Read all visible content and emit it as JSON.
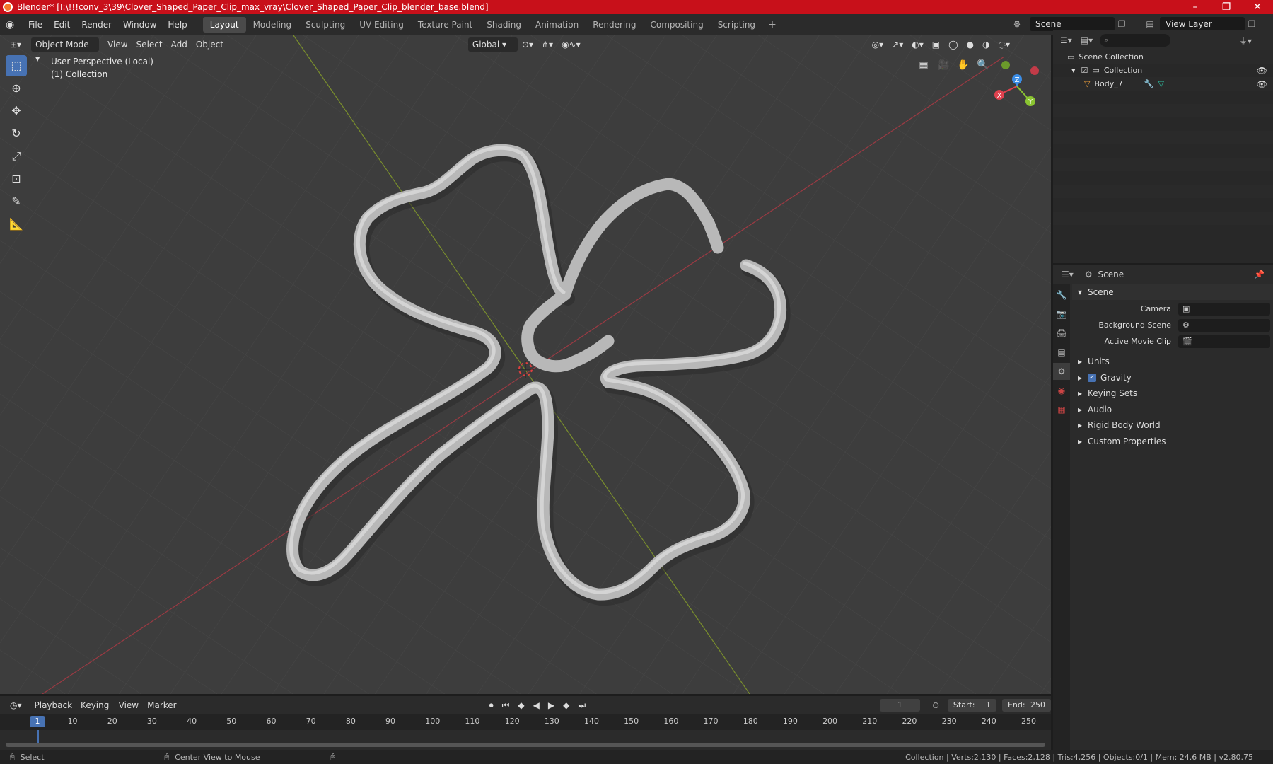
{
  "window": {
    "title": "Blender* [I:\\!!!conv_3\\39\\Clover_Shaped_Paper_Clip_max_vray\\Clover_Shaped_Paper_Clip_blender_base.blend]",
    "min": "–",
    "max": "❐",
    "close": "✕"
  },
  "menu": {
    "file": "File",
    "edit": "Edit",
    "render": "Render",
    "window": "Window",
    "help": "Help"
  },
  "workspaces": [
    "Layout",
    "Modeling",
    "Sculpting",
    "UV Editing",
    "Texture Paint",
    "Shading",
    "Animation",
    "Rendering",
    "Compositing",
    "Scripting"
  ],
  "workspace_add": "+",
  "scene_name": "Scene",
  "view_layer": "View Layer",
  "viewport": {
    "mode": "Object Mode",
    "menus": {
      "view": "View",
      "select": "Select",
      "add": "Add",
      "object": "Object"
    },
    "orientation": "Global",
    "overlay_line1": "User Perspective (Local)",
    "overlay_line2": "(1) Collection"
  },
  "gizmo": {
    "x": "X",
    "y": "Y",
    "z": "Z"
  },
  "outliner": {
    "search_placeholder": "",
    "scene_collection": "Scene Collection",
    "collection": "Collection",
    "object": "Body_7"
  },
  "properties": {
    "header": "Scene",
    "panel": "Scene",
    "camera_label": "Camera",
    "bg_scene_label": "Background Scene",
    "movie_clip_label": "Active Movie Clip",
    "subpanels": {
      "units": "Units",
      "gravity": "Gravity",
      "keying_sets": "Keying Sets",
      "audio": "Audio",
      "rigid_body": "Rigid Body World",
      "custom_props": "Custom Properties"
    }
  },
  "timeline": {
    "menus": {
      "playback": "Playback",
      "keying": "Keying",
      "view": "View",
      "marker": "Marker"
    },
    "current_frame": "1",
    "start_label": "Start:",
    "start": "1",
    "end_label": "End:",
    "end": "250",
    "ruler_ticks": [
      "1",
      "10",
      "20",
      "30",
      "40",
      "50",
      "60",
      "70",
      "80",
      "90",
      "100",
      "110",
      "120",
      "130",
      "140",
      "150",
      "160",
      "170",
      "180",
      "190",
      "200",
      "210",
      "220",
      "230",
      "240",
      "250"
    ]
  },
  "status": {
    "select": "Select",
    "center_view": "Center View to Mouse",
    "stats": "Collection | Verts:2,130 | Faces:2,128 | Tris:4,256 | Objects:0/1 | Mem: 24.6 MB | v2.80.75"
  },
  "colors": {
    "accent": "#4772b3",
    "titlebar": "#c8101a",
    "x_axis": "#e0414e",
    "y_axis": "#8ac431",
    "z_axis": "#3b8de6"
  }
}
